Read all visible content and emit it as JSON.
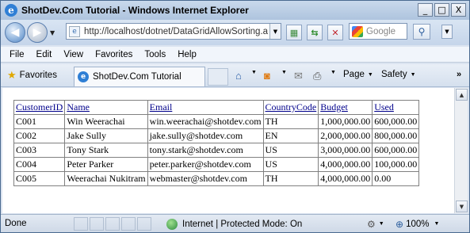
{
  "window": {
    "title": "ShotDev.Com Tutorial - Windows Internet Explorer",
    "buttons": {
      "minimize": "_",
      "maximize": "□",
      "close": "X"
    }
  },
  "address_bar": {
    "url": "http://localhost/dotnet/DataGridAllowSorting.aspx",
    "search_placeholder": "Google"
  },
  "menu": [
    "File",
    "Edit",
    "View",
    "Favorites",
    "Tools",
    "Help"
  ],
  "favorites_bar": {
    "favorites_label": "Favorites",
    "tab_title": "ShotDev.Com Tutorial",
    "page_label": "Page",
    "safety_label": "Safety",
    "more": "»"
  },
  "grid": {
    "columns": [
      "CustomerID",
      "Name",
      "Email",
      "CountryCode",
      "Budget",
      "Used"
    ],
    "rows": [
      [
        "C001",
        "Win Weerachai",
        "win.weerachai@shotdev.com",
        "TH",
        "1,000,000.00",
        "600,000.00"
      ],
      [
        "C002",
        "Jake Sully",
        "jake.sully@shotdev.com",
        "EN",
        "2,000,000.00",
        "800,000.00"
      ],
      [
        "C003",
        "Tony Stark",
        "tony.stark@shotdev.com",
        "US",
        "3,000,000.00",
        "600,000.00"
      ],
      [
        "C004",
        "Peter Parker",
        "peter.parker@shotdev.com",
        "US",
        "4,000,000.00",
        "100,000.00"
      ],
      [
        "C005",
        "Weerachai Nukitram",
        "webmaster@shotdev.com",
        "TH",
        "4,000,000.00",
        "0.00"
      ]
    ]
  },
  "status_bar": {
    "status": "Done",
    "zone": "Internet | Protected Mode: On",
    "zoom": "100%"
  }
}
